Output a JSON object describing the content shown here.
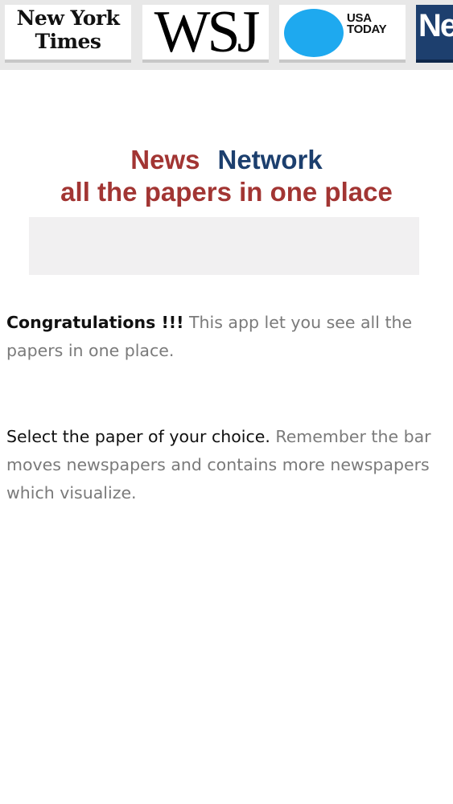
{
  "paper_bar": {
    "papers": [
      {
        "id": "nyt",
        "line1": "New York",
        "line2": "Times"
      },
      {
        "id": "wsj",
        "label": "WSJ"
      },
      {
        "id": "usatoday",
        "line1": "USA",
        "line2": "TODAY"
      },
      {
        "id": "newsweek",
        "label": "Ne"
      }
    ]
  },
  "brand": {
    "word1": "News",
    "word2": "Network",
    "tagline": "all the papers in one place"
  },
  "intro": {
    "lead": "Congratulations !!!",
    "text": " This app let you see all the papers in one place."
  },
  "instructions": {
    "lead": "Select the paper of your choice.",
    "text": " Remember the bar moves newspapers and contains more newspapers which visualize."
  },
  "colors": {
    "brand_red": "#a23533",
    "brand_blue": "#1c3f6e",
    "usa_today_blue": "#1ea9ef",
    "body_gray": "#7a7a7a"
  }
}
